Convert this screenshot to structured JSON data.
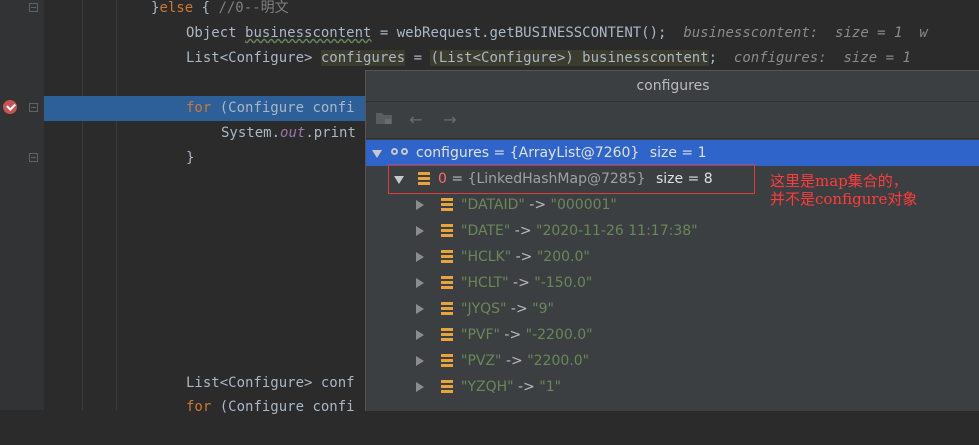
{
  "editor": {
    "lines": [
      {
        "pre": "}",
        "kw": "else",
        "post": " { ",
        "comment": "//0--明文"
      },
      {
        "a": "Object ",
        "var": "businesscontent",
        "b": " = webRequest.getBUSINESSCONTENT();",
        "hint": "  businesscontent:  size = 1  w"
      },
      {
        "a": "List<Configure> ",
        "var": "configures",
        "b": " = ",
        "cast": "(List<Configure>) businesscontent",
        "c": ";",
        "hint": "  configures:  size = 1"
      },
      {
        "kw": "for",
        "rest": " (Configure confi"
      },
      {
        "a": "System.",
        "it": "out",
        "b": ".print"
      },
      {
        "a": "}"
      },
      {
        "a": "List<Configure> conf"
      },
      {
        "kw": "for",
        "rest": " (Configure confi"
      }
    ]
  },
  "popup": {
    "title": "configures",
    "toolbar": {
      "back_icon": "arrow-left-icon",
      "forward_icon": "arrow-right-icon",
      "folder_icon": "folder-icon"
    },
    "root": {
      "name": "configures",
      "eq": " = ",
      "value": "{ArrayList@7260}",
      "size": "size = 1"
    },
    "child": {
      "name": "0",
      "eq": " = ",
      "value": "{LinkedHashMap@7285}",
      "size": "size = 8"
    },
    "entries": [
      {
        "key": "\"DATAID\"",
        "arrow": " -> ",
        "val": "\"000001\""
      },
      {
        "key": "\"DATE\"",
        "arrow": " -> ",
        "val": "\"2020-11-26 11:17:38\""
      },
      {
        "key": "\"HCLK\"",
        "arrow": " -> ",
        "val": "\"200.0\""
      },
      {
        "key": "\"HCLT\"",
        "arrow": " -> ",
        "val": "\"-150.0\""
      },
      {
        "key": "\"JYQS\"",
        "arrow": " -> ",
        "val": "\"9\""
      },
      {
        "key": "\"PVF\"",
        "arrow": " -> ",
        "val": "\"-2200.0\""
      },
      {
        "key": "\"PVZ\"",
        "arrow": " -> ",
        "val": "\"2200.0\""
      },
      {
        "key": "\"YZQH\"",
        "arrow": " -> ",
        "val": "\"1\""
      }
    ]
  },
  "annotation": {
    "line1": "这里是map集合的，",
    "line2": "并不是configure对象"
  },
  "colors": {
    "highlight": "#2d6099",
    "selection": "#2f65ca",
    "keyword": "#cc7832",
    "annotation": "#ff3b3b"
  }
}
